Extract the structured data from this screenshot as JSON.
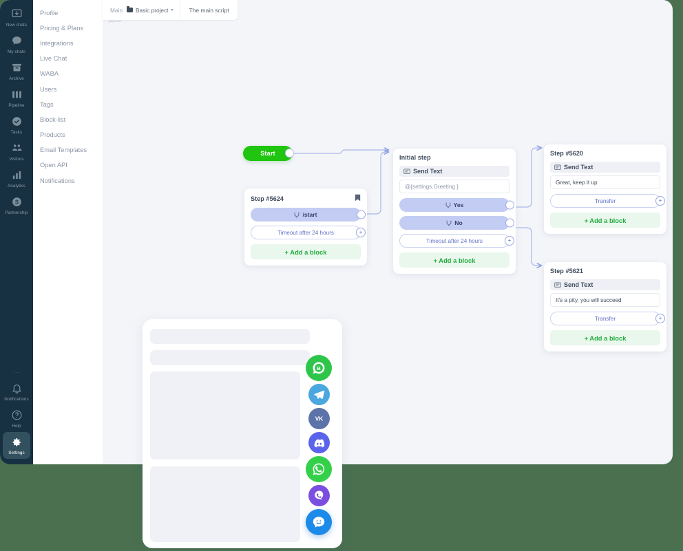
{
  "colors": {
    "page_background": "#4a7050",
    "rail": "#173042",
    "canvas": "#f4f5f9",
    "accent_green": "#1fc50e",
    "accent_blue": "#c3cdf4",
    "add_block_green": "#23ac3f"
  },
  "rail": {
    "items": [
      {
        "label": "New chats",
        "icon": "inbox-download-icon",
        "active": false
      },
      {
        "label": "My chats",
        "icon": "chat-bubble-icon",
        "active": false
      },
      {
        "label": "Archive",
        "icon": "archive-box-icon",
        "active": false
      },
      {
        "label": "Pipeline",
        "icon": "columns-icon",
        "active": false
      },
      {
        "label": "Tasks",
        "icon": "check-circle-icon",
        "active": false
      },
      {
        "label": "Visitors",
        "icon": "visitors-icon",
        "active": false
      },
      {
        "label": "Analytics",
        "icon": "bar-chart-icon",
        "active": false
      },
      {
        "label": "Partnership",
        "icon": "dollar-circle-icon",
        "active": false
      }
    ],
    "overflow": "...",
    "bottom_items": [
      {
        "label": "Notifications",
        "icon": "bell-icon",
        "active": false
      },
      {
        "label": "Help",
        "icon": "question-circle-icon",
        "active": false
      },
      {
        "label": "Settings",
        "icon": "gear-icon",
        "active": true
      }
    ]
  },
  "settings_menu": {
    "items": [
      {
        "label": "Profile"
      },
      {
        "label": "Pricing & Plans"
      },
      {
        "label": "Integrations"
      },
      {
        "label": "Live Chat"
      },
      {
        "label": "WABA"
      },
      {
        "label": "Users"
      },
      {
        "label": "Tags"
      },
      {
        "label": "Block-list"
      },
      {
        "label": "Products"
      },
      {
        "label": "Email Templates"
      },
      {
        "label": "Open API"
      },
      {
        "label": "Notifications"
      }
    ]
  },
  "breadcrumb": {
    "root": "Main",
    "project": "Basic project",
    "script_tab": "The main script"
  },
  "watermark": "gojs.net",
  "flow": {
    "start": {
      "label": "Start"
    },
    "nodes": [
      {
        "title": "Step #5624",
        "bookmarked": true,
        "buttons": [
          {
            "label": "/start",
            "icon": "reply-arrow-icon"
          }
        ],
        "timeout": "Timeout after 24 hours",
        "add_block": "+ Add a block"
      },
      {
        "title": "Initial step",
        "bookmarked": false,
        "block_type": "Send Text",
        "message": "@{settings.Greeting }",
        "message_muted": true,
        "buttons": [
          {
            "label": "Yes",
            "icon": "reply-arrow-icon"
          },
          {
            "label": "No",
            "icon": "reply-arrow-icon"
          }
        ],
        "timeout": "Timeout after 24 hours",
        "add_block": "+ Add a block"
      },
      {
        "title": "Step #5620",
        "bookmarked": false,
        "block_type": "Send Text",
        "message": "Great, keep it up",
        "message_muted": false,
        "action": "Transfer",
        "add_block": "+ Add a block"
      },
      {
        "title": "Step #5621",
        "bookmarked": false,
        "block_type": "Send Text",
        "message": "It's a pity, you will succeed",
        "message_muted": false,
        "action": "Transfer",
        "add_block": "+ Add a block"
      }
    ]
  },
  "widget": {
    "channels": [
      {
        "name": "whatsapp-business-icon",
        "color": "#2ec64a"
      },
      {
        "name": "telegram-icon",
        "color": "#4aa7e0"
      },
      {
        "name": "vk-icon",
        "color": "#5b73a8"
      },
      {
        "name": "discord-icon",
        "color": "#5a63ea"
      },
      {
        "name": "whatsapp-icon",
        "color": "#35d04a"
      },
      {
        "name": "viber-icon",
        "color": "#7a4fe0"
      },
      {
        "name": "chat-widget-icon",
        "color": "#1c8ae8"
      }
    ]
  }
}
